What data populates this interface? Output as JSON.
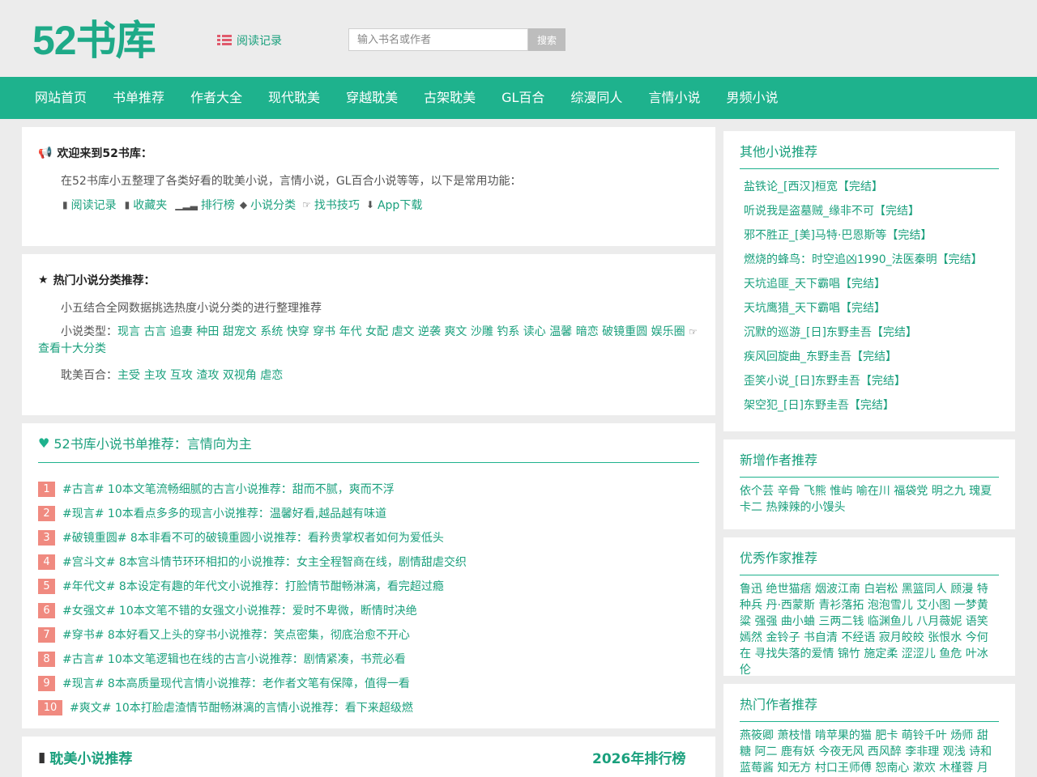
{
  "header": {
    "logo": "52书库",
    "history_link": "阅读记录",
    "search_placeholder": "输入书名或作者",
    "search_button": "搜索"
  },
  "nav": [
    "网站首页",
    "书单推荐",
    "作者大全",
    "现代耽美",
    "穿越耽美",
    "古架耽美",
    "GL百合",
    "综漫同人",
    "言情小说",
    "男频小说"
  ],
  "welcome": {
    "title": "欢迎来到52书库：",
    "intro": "在52书库小五整理了各类好看的耽美小说，言情小说，GL百合小说等等，以下是常用功能：",
    "links": [
      "阅读记录",
      "收藏夹",
      "排行榜",
      "小说分类",
      "找书技巧",
      "App下载"
    ]
  },
  "hot": {
    "title": "热门小说分类推荐：",
    "intro": "小五结合全网数据挑选热度小说分类的进行整理推荐",
    "types_label": "小说类型：",
    "types": [
      "现言",
      "古言",
      "追妻",
      "种田",
      "甜宠文",
      "系统",
      "快穿",
      "穿书",
      "年代",
      "女配",
      "虐文",
      "逆袭",
      "爽文",
      "沙雕",
      "钓系",
      "读心",
      "温馨",
      "暗恋",
      "破镜重圆",
      "娱乐圈"
    ],
    "top_link": "查看十大分类",
    "bl_label": "耽美百合：",
    "bl": [
      "主受",
      "主攻",
      "互攻",
      "渣攻",
      "双视角",
      "虐恋"
    ]
  },
  "booklist": {
    "title": "52书库小说书单推荐：言情向为主",
    "items": [
      {
        "num": "1",
        "text": "#古言# 10本文笔流畅细腻的古言小说推荐：甜而不腻，爽而不浮"
      },
      {
        "num": "2",
        "text": "#现言# 10本看点多多的现言小说推荐：温馨好看,越品越有味道"
      },
      {
        "num": "3",
        "text": "#破镜重圆# 8本非看不可的破镜重圆小说推荐：看矜贵掌权者如何为爱低头"
      },
      {
        "num": "4",
        "text": "#宫斗文# 8本宫斗情节环环相扣的小说推荐：女主全程智商在线，剧情甜虐交织"
      },
      {
        "num": "5",
        "text": "#年代文# 8本设定有趣的年代文小说推荐：打脸情节酣畅淋漓，看完超过瘾"
      },
      {
        "num": "6",
        "text": "#女强文# 10本文笔不错的女强文小说推荐：爱时不卑微，断情时决绝"
      },
      {
        "num": "7",
        "text": "#穿书# 8本好看又上头的穿书小说推荐：笑点密集，彻底治愈不开心"
      },
      {
        "num": "8",
        "text": "#古言# 10本文笔逻辑也在线的古言小说推荐：剧情紧凑，书荒必看"
      },
      {
        "num": "9",
        "text": "#现言# 8本高质量现代言情小说推荐：老作者文笔有保障，值得一看"
      },
      {
        "num": "10",
        "text": "#爽文# 10本打脸虐渣情节酣畅淋漓的言情小说推荐：看下来超级燃"
      }
    ]
  },
  "bl_section": {
    "title": "耽美小说推荐",
    "rank": "2026年排行榜"
  },
  "sidebar": {
    "other": {
      "title": "其他小说推荐",
      "items": [
        "盐铁论_[西汉]桓宽【完结】",
        "听说我是盗墓贼_缘非不可【完结】",
        "邪不胜正_[美]马特·巴恩斯等【完结】",
        "燃烧的蜂鸟：时空追凶1990_法医秦明【完结】",
        "天坑追匪_天下霸唱【完结】",
        "天坑鹰猎_天下霸唱【完结】",
        "沉默的巡游_[日]东野圭吾【完结】",
        "疾风回旋曲_东野圭吾【完结】",
        "歪笑小说_[日]东野圭吾【完结】",
        "架空犯_[日]东野圭吾【完结】"
      ]
    },
    "new_authors": {
      "title": "新增作者推荐",
      "names": "依个芸 辛骨 飞熊 惟屿 喻在川 福袋党 明之九 瑰夏 卡二 热辣辣的小馒头"
    },
    "good_authors": {
      "title": "优秀作家推荐",
      "names": "鲁迅 绝世猫痞 烟波江南 白岩松 黑篮同人 顾漫 特种兵 丹·西蒙斯 青衫落拓 泡泡雪儿 艾小图 一梦黄粱 强强 曲小蛐 三两二钱 临渊鱼儿 八月薇妮 语笑嫣然 金铃子 书自清 不经语 寂月皎皎 张恨水 今何在 寻找失落的爱情 锦竹 施定柔 涩涩儿 鱼危 叶冰伦"
    },
    "hot_authors": {
      "title": "热门作者推荐",
      "names": "燕筱卿 萧枝惜 啃苹果的猫 肥卡 萌铃千叶 炀师 甜糖 阿二 鹿有妖 今夜无风 西风醉 李非理 观浅 诗和蓝莓酱 知无方 村口王师傅 恕南心 漱欢 木槿蓉 月见花时"
    }
  }
}
